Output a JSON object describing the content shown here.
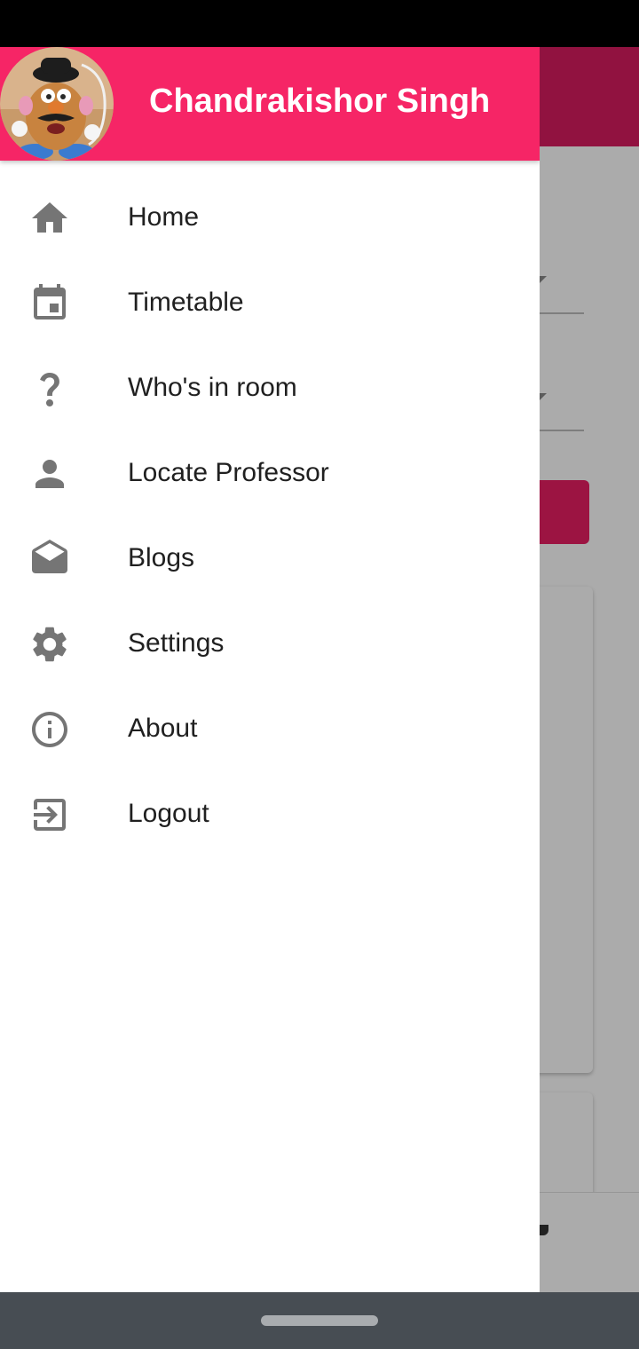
{
  "user": {
    "name": "Chandrakishor Singh"
  },
  "menu": {
    "items": [
      {
        "label": "Home",
        "icon": "home-icon"
      },
      {
        "label": "Timetable",
        "icon": "calendar-icon"
      },
      {
        "label": "Who's in room",
        "icon": "help-icon"
      },
      {
        "label": "Locate Professor",
        "icon": "person-icon"
      },
      {
        "label": "Blogs",
        "icon": "drafts-icon"
      },
      {
        "label": "Settings",
        "icon": "gear-icon"
      },
      {
        "label": "About",
        "icon": "info-icon"
      },
      {
        "label": "Logout",
        "icon": "exit-icon"
      }
    ]
  },
  "background": {
    "bottom_nav_label": "nts"
  },
  "colors": {
    "header": "#f62566",
    "app_bar": "#d81b60",
    "accent": "#e91e63",
    "icon": "#757575"
  }
}
